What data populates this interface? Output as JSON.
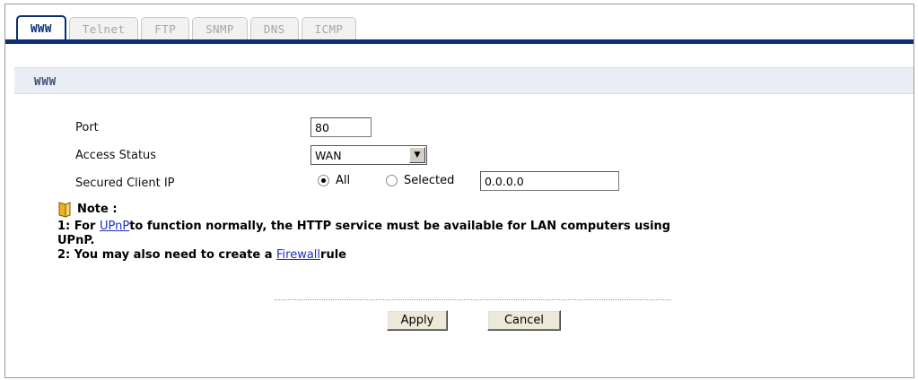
{
  "tabs": [
    {
      "label": "WWW",
      "active": true
    },
    {
      "label": "Telnet",
      "active": false
    },
    {
      "label": "FTP",
      "active": false
    },
    {
      "label": "SNMP",
      "active": false
    },
    {
      "label": "DNS",
      "active": false
    },
    {
      "label": "ICMP",
      "active": false
    }
  ],
  "section": {
    "title": "WWW"
  },
  "form": {
    "port": {
      "label": "Port",
      "value": "80"
    },
    "access_status": {
      "label": "Access Status",
      "value": "WAN"
    },
    "secured_client_ip": {
      "label": "Secured Client IP",
      "option_all": "All",
      "option_selected": "Selected",
      "selected_option": "All",
      "ip_value": "0.0.0.0"
    }
  },
  "note": {
    "title": "Note :",
    "line1_prefix": "1: For ",
    "line1_link": "UPnP",
    "line1_suffix": "to function normally, the HTTP service must be available for LAN computers using",
    "line1_cont": "UPnP.",
    "line2_prefix": "2: You may also need to create a ",
    "line2_link": "Firewall",
    "line2_suffix": "rule"
  },
  "buttons": {
    "apply": "Apply",
    "cancel": "Cancel"
  },
  "colors": {
    "accent": "#0b2e74",
    "section_bg": "#e9eef5",
    "link": "#1a2fbb"
  }
}
